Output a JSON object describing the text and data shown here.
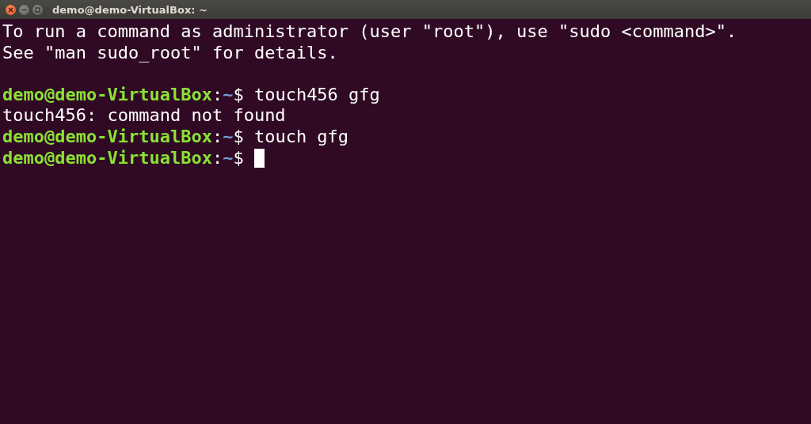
{
  "window": {
    "title": "demo@demo-VirtualBox: ~",
    "buttons": [
      {
        "kind": "close"
      },
      {
        "kind": "minimize"
      },
      {
        "kind": "maximize"
      }
    ]
  },
  "lines": [
    {
      "kind": "output",
      "text": "To run a command as administrator (user \"root\"), use \"sudo <command>\"."
    },
    {
      "kind": "output",
      "text": "See \"man sudo_root\" for details."
    },
    {
      "kind": "blank"
    },
    {
      "kind": "prompt",
      "user_host": "demo@demo-VirtualBox",
      "separator": ":",
      "path": "~",
      "symbol": "$",
      "command": "touch456 gfg",
      "cursor": false
    },
    {
      "kind": "output",
      "text": "touch456: command not found"
    },
    {
      "kind": "prompt",
      "user_host": "demo@demo-VirtualBox",
      "separator": ":",
      "path": "~",
      "symbol": "$",
      "command": "touch gfg",
      "cursor": false
    },
    {
      "kind": "prompt",
      "user_host": "demo@demo-VirtualBox",
      "separator": ":",
      "path": "~",
      "symbol": "$",
      "cursor": true
    }
  ]
}
